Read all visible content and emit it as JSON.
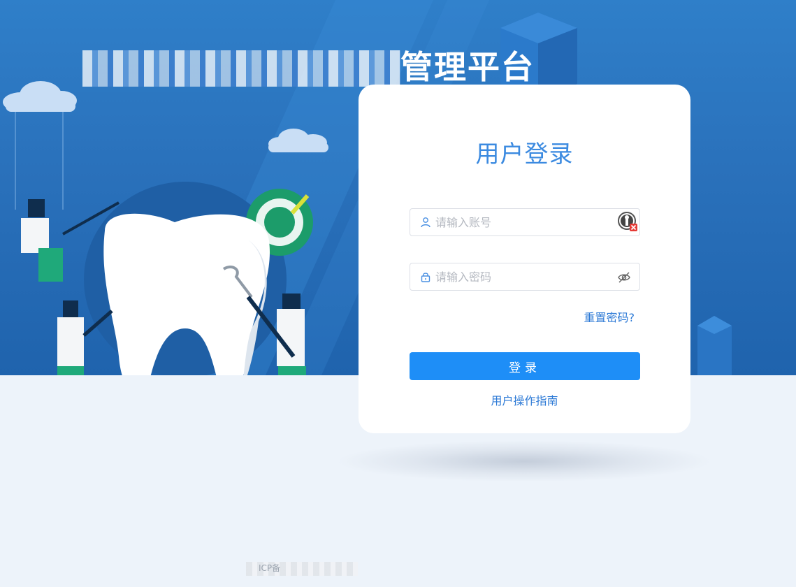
{
  "header": {
    "platform_title_visible": "管理平台"
  },
  "login": {
    "title": "用户登录",
    "username": {
      "placeholder": "请输入账号",
      "value": "",
      "icon": "user-icon",
      "badge_icon": "password-manager-icon"
    },
    "password": {
      "placeholder": "请输入密码",
      "value": "",
      "icon": "lock-icon",
      "toggle_icon": "eye-off-icon"
    },
    "reset_password_label": "重置密码?",
    "submit_label": "登录",
    "guide_label": "用户操作指南"
  },
  "footer": {
    "record_text": "ICP备"
  },
  "colors": {
    "background_blue": "#2a71bb",
    "ground": "#edf3fa",
    "accent": "#1e8ef7",
    "title_blue": "#3b8ae0",
    "link_blue": "#2d7ad6"
  }
}
